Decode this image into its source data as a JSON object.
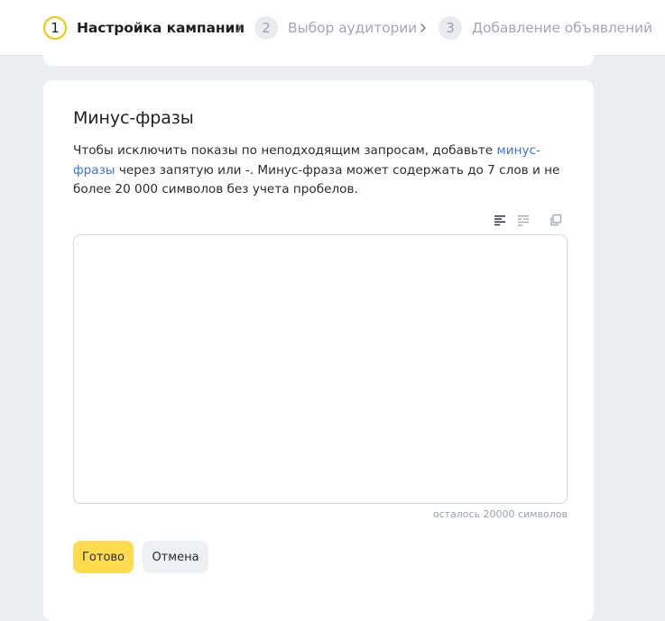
{
  "stepper": {
    "steps": [
      {
        "number": "1",
        "label": "Настройка кампании",
        "state": "active"
      },
      {
        "number": "2",
        "label": "Выбор аудитории",
        "state": "inactive"
      },
      {
        "number": "3",
        "label": "Добавление объявлений",
        "state": "inactive"
      }
    ]
  },
  "card": {
    "title": "Минус-фразы",
    "description_before_link": "Чтобы исключить показы по неподходящим запросам, добавьте ",
    "description_link": "минус-фразы",
    "description_after_link": " через запятую или -. Минус-фраза может содержать до 7 слов и не более 20 000 символов без учета пробелов.",
    "toolbar_icons": [
      "align-left-icon",
      "list-icon",
      "copy-icon"
    ],
    "textarea_value": "",
    "counter": "осталось 20000 символов",
    "buttons": {
      "done": "Готово",
      "cancel": "Отмена"
    }
  },
  "colors": {
    "accent_yellow": "#ffdc4e",
    "step_active_ring": "#f5c400",
    "link": "#3e74d6",
    "page_background": "#edeef2"
  }
}
